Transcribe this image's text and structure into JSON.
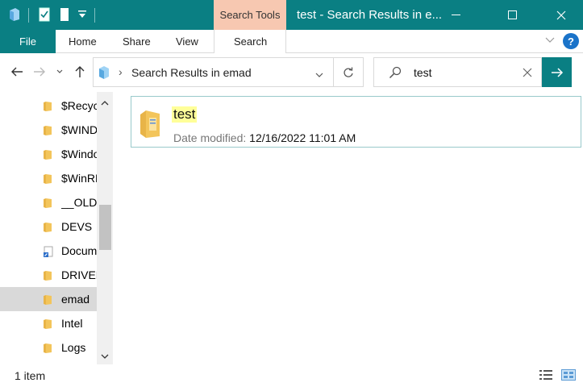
{
  "window": {
    "title": "test - Search Results in e...",
    "context_tab": "Search Tools"
  },
  "ribbon": {
    "tabs": [
      "File",
      "Home",
      "Share",
      "View",
      "Search"
    ],
    "help_label": "?"
  },
  "address": {
    "breadcrumb_sep": "›",
    "path": "Search Results in emad"
  },
  "search": {
    "value": "test"
  },
  "nav_pane": {
    "items": [
      {
        "label": "$Recycle.Bin",
        "icon": "folder-icon"
      },
      {
        "label": "$WINDOWS.~BT",
        "icon": "folder-icon"
      },
      {
        "label": "$Windows.~WS",
        "icon": "folder-icon"
      },
      {
        "label": "$WinREAgent",
        "icon": "folder-icon"
      },
      {
        "label": "__OLD__",
        "icon": "folder-icon"
      },
      {
        "label": "DEVS",
        "icon": "folder-icon"
      },
      {
        "label": "Documents and Settings",
        "icon": "shortcut-folder-icon"
      },
      {
        "label": "DRIVERS",
        "icon": "folder-icon"
      },
      {
        "label": "emad",
        "icon": "folder-icon",
        "selected": true
      },
      {
        "label": "Intel",
        "icon": "folder-icon"
      },
      {
        "label": "Logs",
        "icon": "folder-icon"
      }
    ]
  },
  "results": [
    {
      "name": "test",
      "meta_label": "Date modified:",
      "meta_value": "12/16/2022 11:01 AM"
    }
  ],
  "status": {
    "item_count": "1 item"
  },
  "colors": {
    "accent": "#0a7f83",
    "context_tab": "#f7c8b1",
    "highlight": "#ffff99",
    "folder": "#f3c55b"
  }
}
